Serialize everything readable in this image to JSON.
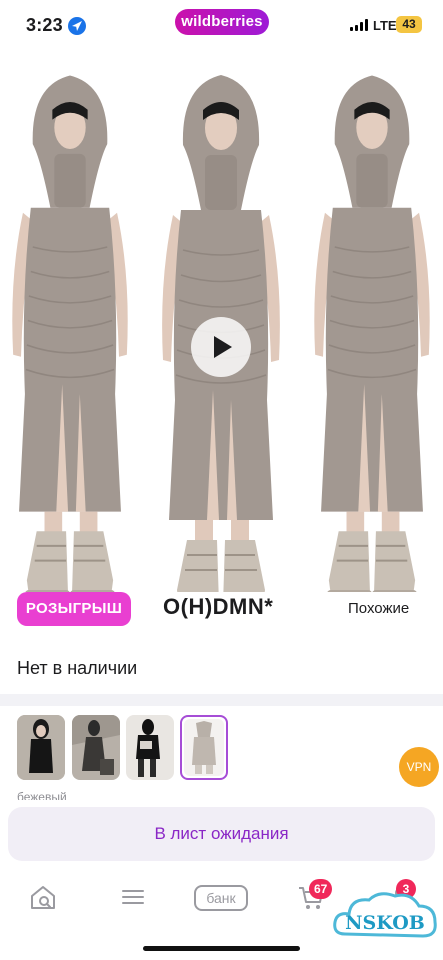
{
  "status_bar": {
    "time": "3:23",
    "network": "LTE",
    "battery": "43",
    "brand": "wildberries"
  },
  "product": {
    "promo_label": "РОЗЫГРЫШ",
    "brand": "O(H)DMN*",
    "similar_label": "Похожие",
    "availability": "Нет в наличии",
    "color_name": "бежевый",
    "waitlist_label": "В лист ожидания"
  },
  "variants": [
    {
      "name": "variant-black-dress",
      "selected": false
    },
    {
      "name": "variant-dark-dress",
      "selected": false
    },
    {
      "name": "variant-black-top",
      "selected": false
    },
    {
      "name": "variant-beige-dress",
      "selected": true
    }
  ],
  "overlay": {
    "vpn_label": "VPN"
  },
  "tab_bar": {
    "bank_label": "банк",
    "cart_count": "67",
    "profile_count": "3"
  },
  "watermark": {
    "text": "NSKOB"
  },
  "colors": {
    "brand_gradient_start": "#cb11ab",
    "brand_gradient_end": "#9e1bd6",
    "promo": "#e93fd1",
    "waitlist_text": "#8a27c6",
    "badge": "#f0285a",
    "dress": "#a29891"
  }
}
